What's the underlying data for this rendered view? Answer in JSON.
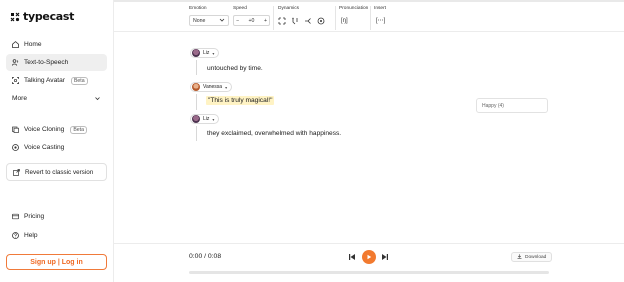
{
  "brand": {
    "name": "typecast",
    "accent": "#f27a2f"
  },
  "sidebar": {
    "items": [
      {
        "label": "Home",
        "icon": "home-icon"
      },
      {
        "label": "Text-to-Speech",
        "icon": "text-to-speech-icon",
        "active": true
      },
      {
        "label": "Talking Avatar",
        "icon": "avatar-icon",
        "badge": "Beta"
      },
      {
        "label": "More",
        "icon": "chevron-down-icon"
      },
      {
        "label": "Voice Cloning",
        "icon": "voice-cloning-icon",
        "badge": "Beta"
      },
      {
        "label": "Voice Casting",
        "icon": "voice-casting-icon"
      }
    ],
    "revert_label": "Revert to classic version",
    "bottom_items": [
      {
        "label": "Pricing",
        "icon": "pricing-icon"
      },
      {
        "label": "Help",
        "icon": "help-icon"
      }
    ],
    "signup_label": "Sign up | Log in"
  },
  "toolbar": {
    "emotion": {
      "label": "Emotion",
      "value": "None"
    },
    "speed": {
      "label": "Speed",
      "minus": "−",
      "value": "+0",
      "plus": "+"
    },
    "dynamics": {
      "label": "Dynamics"
    },
    "pronunciation": {
      "label": "Pronunciation",
      "symbol": "[ŋ]"
    },
    "insert": {
      "label": "Insert",
      "symbol": "[⋯]"
    }
  },
  "editor": {
    "blocks": [
      {
        "speaker": "Liz",
        "text": "untouched by time."
      },
      {
        "speaker": "Vanessa",
        "text": "\"This is truly magical!\""
      },
      {
        "speaker": "Liz",
        "text": "they exclaimed, overwhelmed with happiness."
      }
    ],
    "emotion_tag": "Happy (4)"
  },
  "player": {
    "time": "0:00 / 0:08",
    "progress": 0,
    "download_label": "Download"
  }
}
